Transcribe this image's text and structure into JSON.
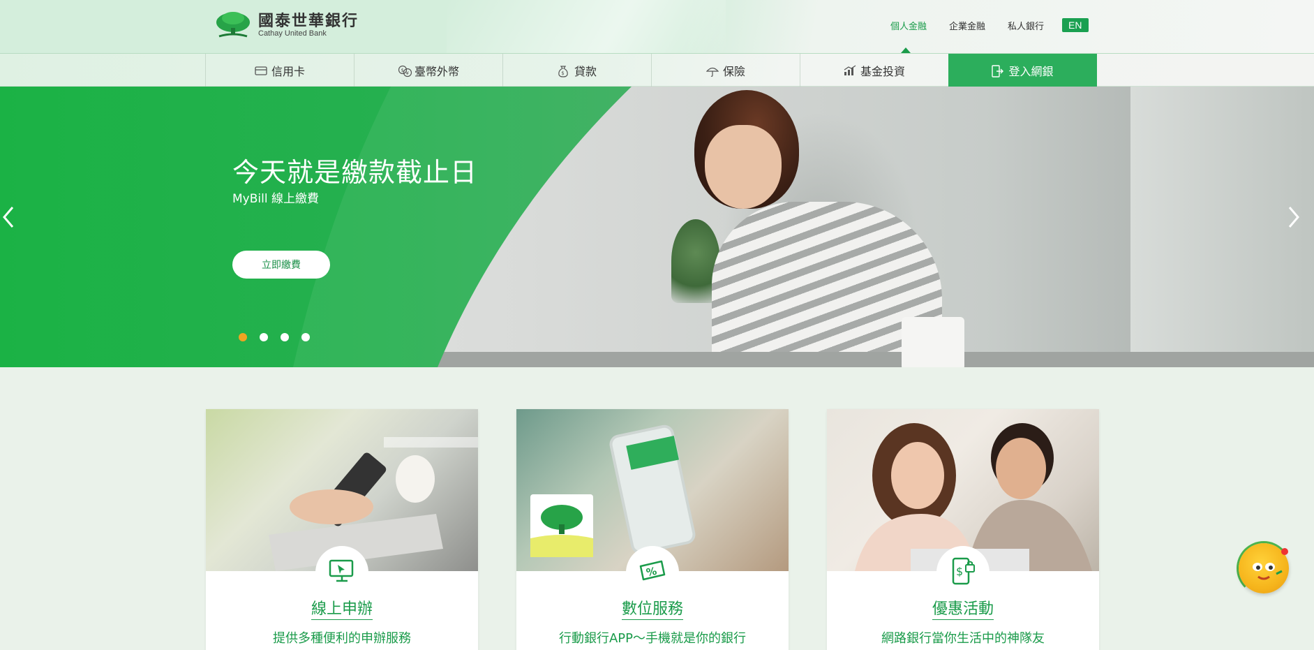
{
  "header": {
    "logo_zh": "國泰世華銀行",
    "logo_en": "Cathay United Bank",
    "top_links": [
      {
        "label": "個人金融",
        "active": true
      },
      {
        "label": "企業金融",
        "active": false
      },
      {
        "label": "私人銀行",
        "active": false
      }
    ],
    "lang_button": "EN"
  },
  "menu": {
    "items": [
      {
        "label": "信用卡",
        "icon": "credit-card-icon"
      },
      {
        "label": "臺幣外幣",
        "icon": "currency-icon"
      },
      {
        "label": "貸款",
        "icon": "money-bag-icon"
      },
      {
        "label": "保險",
        "icon": "umbrella-icon"
      },
      {
        "label": "基金投資",
        "icon": "chart-icon"
      },
      {
        "label": "登入網銀",
        "icon": "login-icon"
      }
    ]
  },
  "hero": {
    "title": "今天就是繳款截止日",
    "subtitle": "MyBill 線上繳費",
    "button": "立即繳費",
    "slides_count": 4,
    "active_slide": 1
  },
  "cards": [
    {
      "title": "線上申辦",
      "desc": "提供多種便利的申辦服務",
      "icon": "monitor-cursor-icon"
    },
    {
      "title": "數位服務",
      "desc": "行動銀行APP～手機就是你的銀行",
      "icon": "percent-tag-icon"
    },
    {
      "title": "優惠活動",
      "desc": "網路銀行當你生活中的神隊友",
      "icon": "phone-dollar-icon"
    }
  ],
  "colors": {
    "brand_green": "#1a9b4a",
    "login_green": "#2cae5c",
    "hero_green": "#22b24c",
    "accent_orange": "#f0a422"
  }
}
